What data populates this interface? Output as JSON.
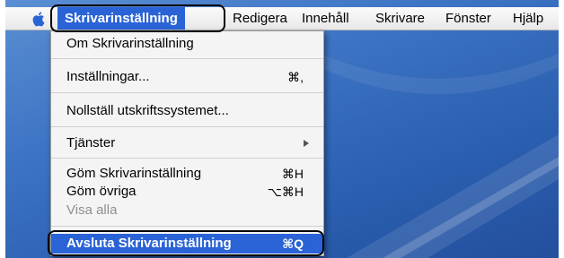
{
  "menubar": {
    "items": [
      {
        "label": "Skrivarinställning"
      },
      {
        "label": "Redigera"
      },
      {
        "label": "Innehåll"
      },
      {
        "label": "Skrivare"
      },
      {
        "label": "Fönster"
      },
      {
        "label": "Hjälp"
      }
    ]
  },
  "menu": {
    "about": "Om Skrivarinställning",
    "preferences": {
      "label": "Inställningar...",
      "shortcut": "⌘,"
    },
    "reset": "Nollställ utskriftssystemet...",
    "services": "Tjänster",
    "hide": {
      "label": "Göm Skrivarinställning",
      "shortcut": "⌘H"
    },
    "hide_others": {
      "label": "Göm övriga",
      "shortcut": "⌥⌘H"
    },
    "show_all": "Visa alla",
    "quit": {
      "label": "Avsluta Skrivarinställning",
      "shortcut": "⌘Q"
    }
  },
  "colors": {
    "menu_highlight": "#2a63d6",
    "desktop": "#3d74c4"
  }
}
